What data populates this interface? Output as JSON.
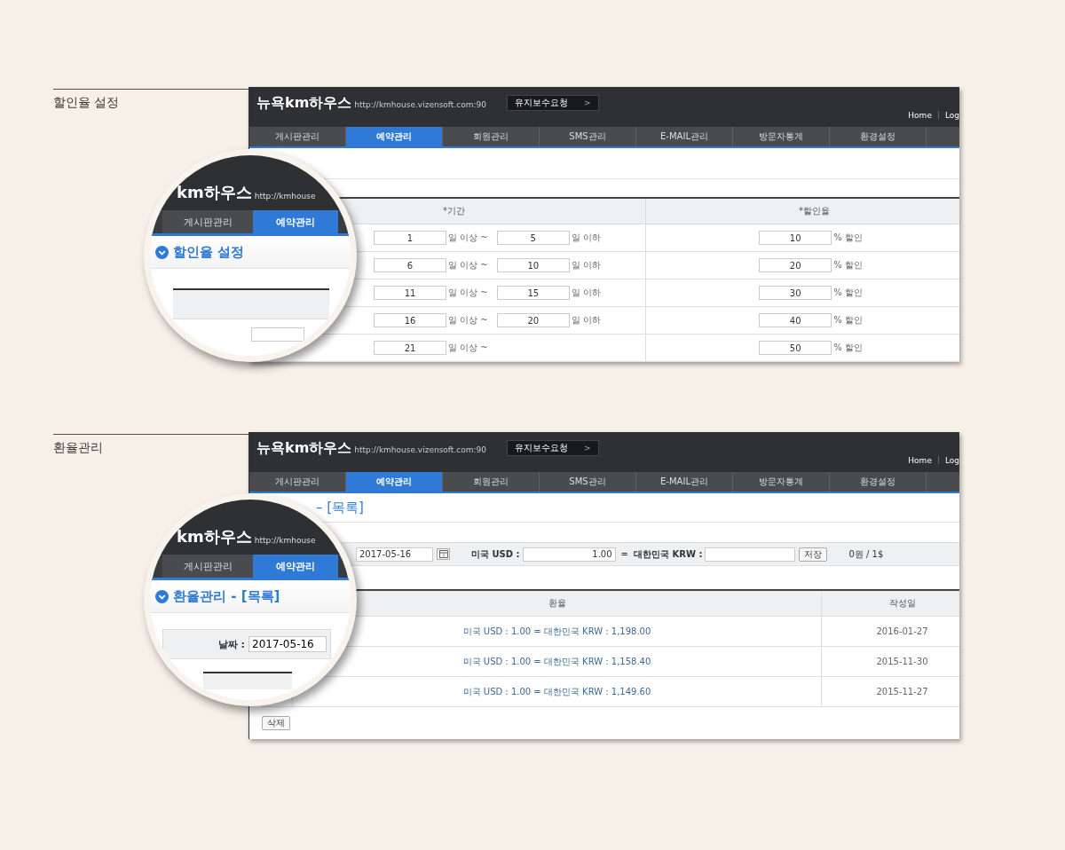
{
  "sections": [
    {
      "kind": "discount",
      "label": "할인율 설정",
      "screen": {
        "brand": "뉴욕km하우스",
        "url": "http://kmhouse.vizensoft.com:90",
        "maintenance_button": "유지보수요청",
        "button_arrow": ">",
        "top_links": [
          "Home",
          "Log"
        ],
        "nav": [
          {
            "label": "게시판관리",
            "selected": false
          },
          {
            "label": "예약관리",
            "selected": true
          },
          {
            "label": "회원관리",
            "selected": false
          },
          {
            "label": "SMS관리",
            "selected": false
          },
          {
            "label": "E-MAIL관리",
            "selected": false
          },
          {
            "label": "방문자통계",
            "selected": false
          },
          {
            "label": "환경설정",
            "selected": false
          }
        ],
        "columns": [
          "*기간",
          "*할인율"
        ],
        "rows": [
          {
            "from": "1",
            "from_unit": "일 이상 ~",
            "to": "5",
            "to_unit": "일 이하",
            "rate": "10",
            "rate_unit": "% 할인"
          },
          {
            "from": "6",
            "from_unit": "일 이상 ~",
            "to": "10",
            "to_unit": "일 이하",
            "rate": "20",
            "rate_unit": "% 할인"
          },
          {
            "from": "11",
            "from_unit": "일 이상 ~",
            "to": "15",
            "to_unit": "일 이하",
            "rate": "30",
            "rate_unit": "% 할인"
          },
          {
            "from": "16",
            "from_unit": "일 이상 ~",
            "to": "20",
            "to_unit": "일 이하",
            "rate": "40",
            "rate_unit": "% 할인"
          },
          {
            "from": "21",
            "from_unit": "일 이상 ~",
            "rate": "50",
            "rate_unit": "% 할인"
          }
        ]
      },
      "magnifier": {
        "brand": "km하우스",
        "url": "http://kmhouse",
        "tabs": [
          {
            "label": "게시판관리",
            "selected": false
          },
          {
            "label": "예약관리",
            "selected": true
          }
        ],
        "title": "할인율 설정"
      }
    },
    {
      "kind": "exchange",
      "label": "환율관리",
      "screen": {
        "brand": "뉴욕km하우스",
        "url": "http://kmhouse.vizensoft.com:90",
        "maintenance_button": "유지보수요청",
        "button_arrow": ">",
        "top_links": [
          "Home",
          "Log"
        ],
        "nav": [
          {
            "label": "게시판관리",
            "selected": false
          },
          {
            "label": "예약관리",
            "selected": true
          },
          {
            "label": "회원관리",
            "selected": false
          },
          {
            "label": "SMS관리",
            "selected": false
          },
          {
            "label": "E-MAIL관리",
            "selected": false
          },
          {
            "label": "방문자통계",
            "selected": false
          },
          {
            "label": "환경설정",
            "selected": false
          }
        ],
        "title_fragment": "– [목록]",
        "form": {
          "date": "2017-05-16",
          "usd_label": "미국 USD :",
          "usd_value": "1.00",
          "equals": "=",
          "krw_label": "대한민국 KRW :",
          "save_button": "저장",
          "rate_info": "0원 / 1$"
        },
        "columns": [
          "환율",
          "작성일"
        ],
        "rows": [
          {
            "rate": "미국 USD : 1.00 = 대한민국 KRW : 1,198.00",
            "date": "2016-01-27"
          },
          {
            "rate": "미국 USD : 1.00 = 대한민국 KRW : 1,158.40",
            "date": "2015-11-30"
          },
          {
            "rate": "미국 USD : 1.00 = 대한민국 KRW : 1,149.60",
            "date": "2015-11-27"
          }
        ],
        "delete_button": "삭제"
      },
      "magnifier": {
        "brand": "km하우스",
        "url": "http://kmhouse",
        "tabs": [
          {
            "label": "게시판관리",
            "selected": false
          },
          {
            "label": "예약관리",
            "selected": true
          }
        ],
        "title": "환율관리 - [목록]",
        "date_label": "날짜 :",
        "date_value": "2017-05-16"
      }
    }
  ]
}
